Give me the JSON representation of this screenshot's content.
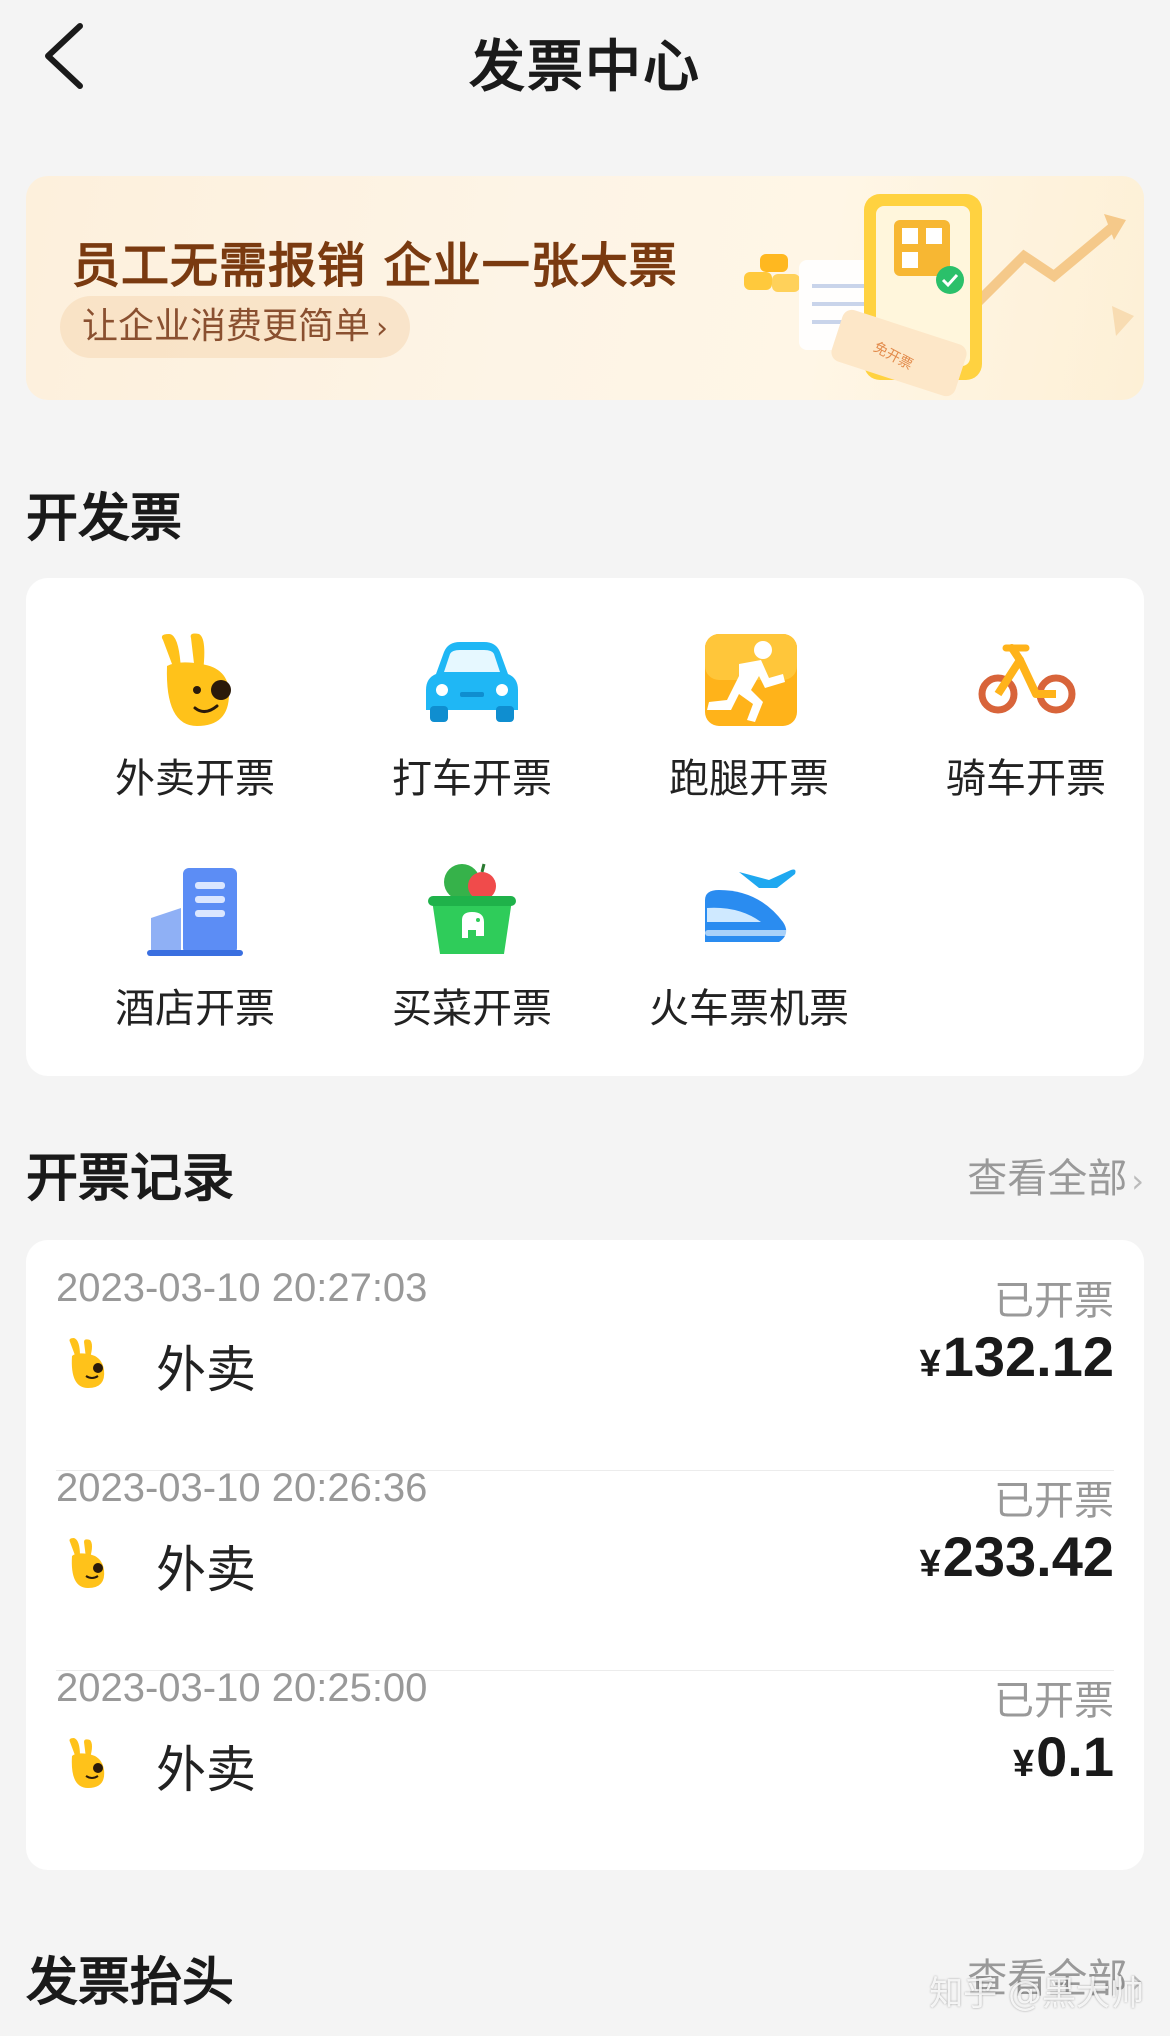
{
  "nav": {
    "title": "发票中心",
    "back_icon": "chevron-left-icon"
  },
  "banner": {
    "title": "员工无需报销 企业一张大票",
    "subtitle": "让企业消费更简单",
    "chevron": "›",
    "art_text": "免开票"
  },
  "issue": {
    "title": "开发票",
    "items": [
      {
        "label": "外卖开票",
        "icon": "kangaroo-icon"
      },
      {
        "label": "打车开票",
        "icon": "car-icon"
      },
      {
        "label": "跑腿开票",
        "icon": "runner-icon"
      },
      {
        "label": "骑车开票",
        "icon": "bike-icon"
      },
      {
        "label": "酒店开票",
        "icon": "hotel-icon"
      },
      {
        "label": "买菜开票",
        "icon": "grocery-basket-icon"
      },
      {
        "label": "火车票机票",
        "icon": "train-plane-icon"
      }
    ]
  },
  "records": {
    "title": "开票记录",
    "view_all": "查看全部",
    "chevron": "›",
    "currency": "¥",
    "items": [
      {
        "time": "2023-03-10 20:27:03",
        "status": "已开票",
        "type": "外卖",
        "amount": "132.12"
      },
      {
        "time": "2023-03-10 20:26:36",
        "status": "已开票",
        "type": "外卖",
        "amount": "233.42"
      },
      {
        "time": "2023-03-10 20:25:00",
        "status": "已开票",
        "type": "外卖",
        "amount": "0.1"
      }
    ]
  },
  "header_section": {
    "title": "发票抬头",
    "view_all": "查看全部",
    "chevron": "›"
  },
  "watermark": "知乎 @黑大帅",
  "colors": {
    "background": "#f4f4f4",
    "card": "#ffffff",
    "brand_yellow": "#ffc21a",
    "banner_text": "#7a3a10",
    "muted": "#999999"
  }
}
